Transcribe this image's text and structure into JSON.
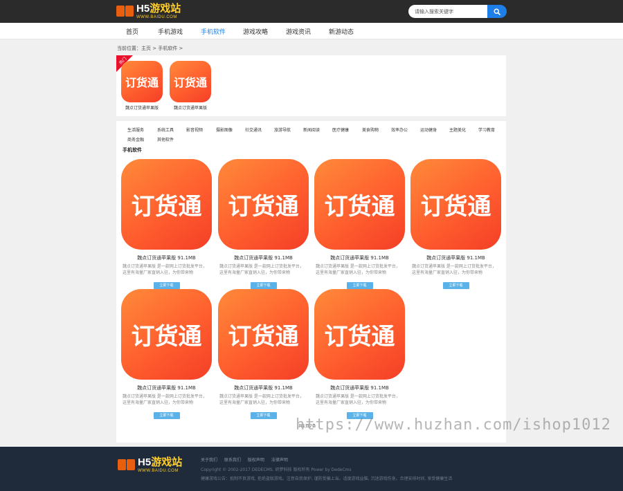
{
  "header": {
    "logo_main": "H5",
    "logo_accent": "游戏站",
    "logo_sub": "WWW.BAIDU.COM",
    "search_placeholder": "请输入搜索关键字"
  },
  "nav": {
    "items": [
      "首页",
      "手机游戏",
      "手机软件",
      "游戏攻略",
      "游戏资讯",
      "新游动态"
    ],
    "active": "手机软件"
  },
  "breadcrumb": "当前位置：主页 > 手机软件 >",
  "featured": {
    "badge": "热门",
    "items": [
      {
        "icon_text": "订货通",
        "caption": "魏点订货通苹果版"
      },
      {
        "icon_text": "订货通",
        "caption": "魏点订货通苹果版"
      }
    ]
  },
  "categories": [
    "生活服务",
    "系统工具",
    "影音视频",
    "摄影图像",
    "社交通讯",
    "旅游导航",
    "新闻阅读",
    "医疗健康",
    "美食购物",
    "效率办公",
    "运动健身",
    "主题美化",
    "学习教育",
    "商务金融",
    "其他软件"
  ],
  "section_title": "手机软件",
  "apps": [
    {
      "icon_text": "订货通",
      "title": "魏点订货通苹果版 91.1MB",
      "desc": "魏点订货通苹果版 是一款网上订货批发平台，这里有海量厂家直销入驻，为你带来物",
      "button": "立即下载"
    },
    {
      "icon_text": "订货通",
      "title": "魏点订货通苹果版 91.1MB",
      "desc": "魏点订货通苹果版 是一款网上订货批发平台，这里有海量厂家直销入驻，为你带来物",
      "button": "立即下载"
    },
    {
      "icon_text": "订货通",
      "title": "魏点订货通苹果版 91.1MB",
      "desc": "魏点订货通苹果版 是一款网上订货批发平台，这里有海量厂家直销入驻，为你带来物",
      "button": "立即下载"
    },
    {
      "icon_text": "订货通",
      "title": "魏点订货通苹果版 91.1MB",
      "desc": "魏点订货通苹果版 是一款网上订货批发平台，这里有海量厂家直销入驻，为你带来物",
      "button": "立即下载"
    },
    {
      "icon_text": "订货通",
      "title": "魏点订货通苹果版 91.1MB",
      "desc": "魏点订货通苹果版 是一款网上订货批发平台，这里有海量厂家直销入驻，为你带来物",
      "button": "立即下载"
    },
    {
      "icon_text": "订货通",
      "title": "魏点订货通苹果版 91.1MB",
      "desc": "魏点订货通苹果版 是一款网上订货批发平台，这里有海量厂家直销入驻，为你带来物",
      "button": "立即下载"
    },
    {
      "icon_text": "订货通",
      "title": "魏点订货通苹果版 91.1MB",
      "desc": "魏点订货通苹果版 是一款网上订货批发平台，这里有海量厂家直销入驻，为你带来物",
      "button": "立即下载"
    }
  ],
  "pager": "共1页7条",
  "footer": {
    "links": [
      "关于我们",
      "联系我们",
      "版权声明",
      "法律声明"
    ],
    "copyright": "Copyright © 2002-2017 DEDECMS. 织梦科技 版权所有 Power by DedeCms",
    "notice": "健康游戏公告：抵制不良游戏, 拒绝盗版游戏。注意自我保护, 谨防受骗上当。适度游戏益脑, 沉迷游戏伤身。合理安排时间, 享受健康生活"
  },
  "watermark": "https://www.huzhan.com/ishop1012",
  "colors": {
    "topbar": "#2b2b2b",
    "accent_blue": "#1e7fe8",
    "icon_orange": "#ff5e2e",
    "download_button": "#5ab2e8",
    "footer": "#1f2b3a"
  }
}
